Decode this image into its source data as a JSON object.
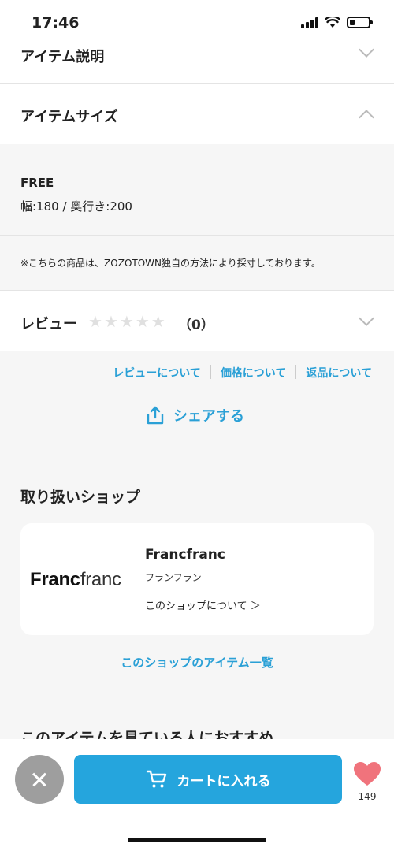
{
  "status_bar": {
    "time": "17:46"
  },
  "accordion": {
    "item_description": "アイテム説明",
    "item_size": "アイテムサイズ",
    "review": "レビュー"
  },
  "size": {
    "name": "FREE",
    "dimensions": "幅:180 / 奥行き:200",
    "note": "※こちらの商品は、ZOZOTOWN独自の方法により採寸しております。"
  },
  "review": {
    "stars_filled": 0,
    "stars_total": 5,
    "count": "（0）"
  },
  "links": {
    "about_reviews": "レビューについて",
    "about_price": "価格について",
    "about_returns": "返品について"
  },
  "share": {
    "label": "シェアする"
  },
  "shop_section": {
    "title": "取り扱いショップ",
    "logo_bold": "Franc",
    "logo_light": "franc",
    "name": "Francfranc",
    "kana": "フランフラン",
    "about": "このショップについて ＞",
    "items_link": "このショップのアイテム一覧"
  },
  "recommend": {
    "title": "このアイテムを見ている人におすすめ"
  },
  "bottom_bar": {
    "cart_label": "カートに入れる",
    "favorite_count": "149"
  },
  "colors": {
    "accent": "#25a5dd",
    "link": "#2aa0d6",
    "heart": "#f0737c",
    "close": "#9e9e9e"
  }
}
